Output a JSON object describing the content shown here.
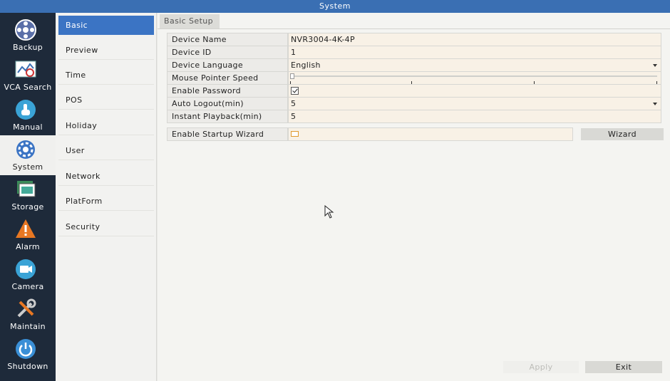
{
  "window": {
    "title": "System"
  },
  "rail": {
    "items": [
      {
        "label": "Backup",
        "icon": "backup-icon"
      },
      {
        "label": "VCA Search",
        "icon": "vca-search-icon"
      },
      {
        "label": "Manual",
        "icon": "manual-icon"
      },
      {
        "label": "System",
        "icon": "gear-icon",
        "active": true
      },
      {
        "label": "Storage",
        "icon": "storage-icon"
      },
      {
        "label": "Alarm",
        "icon": "alarm-icon"
      },
      {
        "label": "Camera",
        "icon": "camera-icon"
      },
      {
        "label": "Maintain",
        "icon": "wrench-icon"
      },
      {
        "label": "Shutdown",
        "icon": "power-icon"
      }
    ]
  },
  "submenu": {
    "items": [
      {
        "label": "Basic",
        "active": true
      },
      {
        "label": "Preview"
      },
      {
        "label": "Time"
      },
      {
        "label": "POS"
      },
      {
        "label": "Holiday"
      },
      {
        "label": "User"
      },
      {
        "label": "Network"
      },
      {
        "label": "PlatForm"
      },
      {
        "label": "Security"
      }
    ]
  },
  "main": {
    "tab": "Basic Setup",
    "fields": {
      "device_name": {
        "label": "Device Name",
        "value": "NVR3004-4K-4P"
      },
      "device_id": {
        "label": "Device ID",
        "value": "1"
      },
      "device_language": {
        "label": "Device Language",
        "value": "English"
      },
      "mouse_speed": {
        "label": "Mouse Pointer Speed",
        "value_fraction": 0.0
      },
      "enable_password": {
        "label": "Enable Password",
        "checked": true
      },
      "auto_logout": {
        "label": "Auto Logout(min)",
        "value": "5"
      },
      "instant_playback": {
        "label": "Instant Playback(min)",
        "value": "5"
      },
      "startup_wizard": {
        "label": "Enable Startup Wizard",
        "checked": false
      }
    },
    "buttons": {
      "wizard": "Wizard",
      "apply": "Apply",
      "exit": "Exit"
    }
  },
  "colors": {
    "titlebar": "#3a6fb3",
    "rail": "#1e2a3a",
    "active_submenu": "#3b74c4",
    "field_value_bg": "#f8f1e6"
  }
}
